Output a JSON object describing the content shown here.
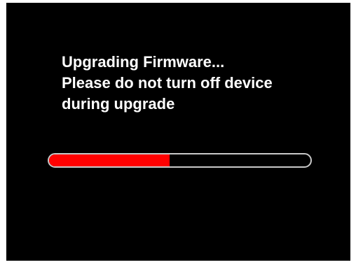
{
  "upgrade_screen": {
    "message_lines": [
      "Upgrading Firmware...",
      "Please do not turn off device",
      "during upgrade"
    ],
    "progress_percent": 46
  },
  "colors": {
    "background": "#000000",
    "text": "#ffffff",
    "progress_fill": "#ff0000",
    "progress_border": "#c8c8c8"
  }
}
